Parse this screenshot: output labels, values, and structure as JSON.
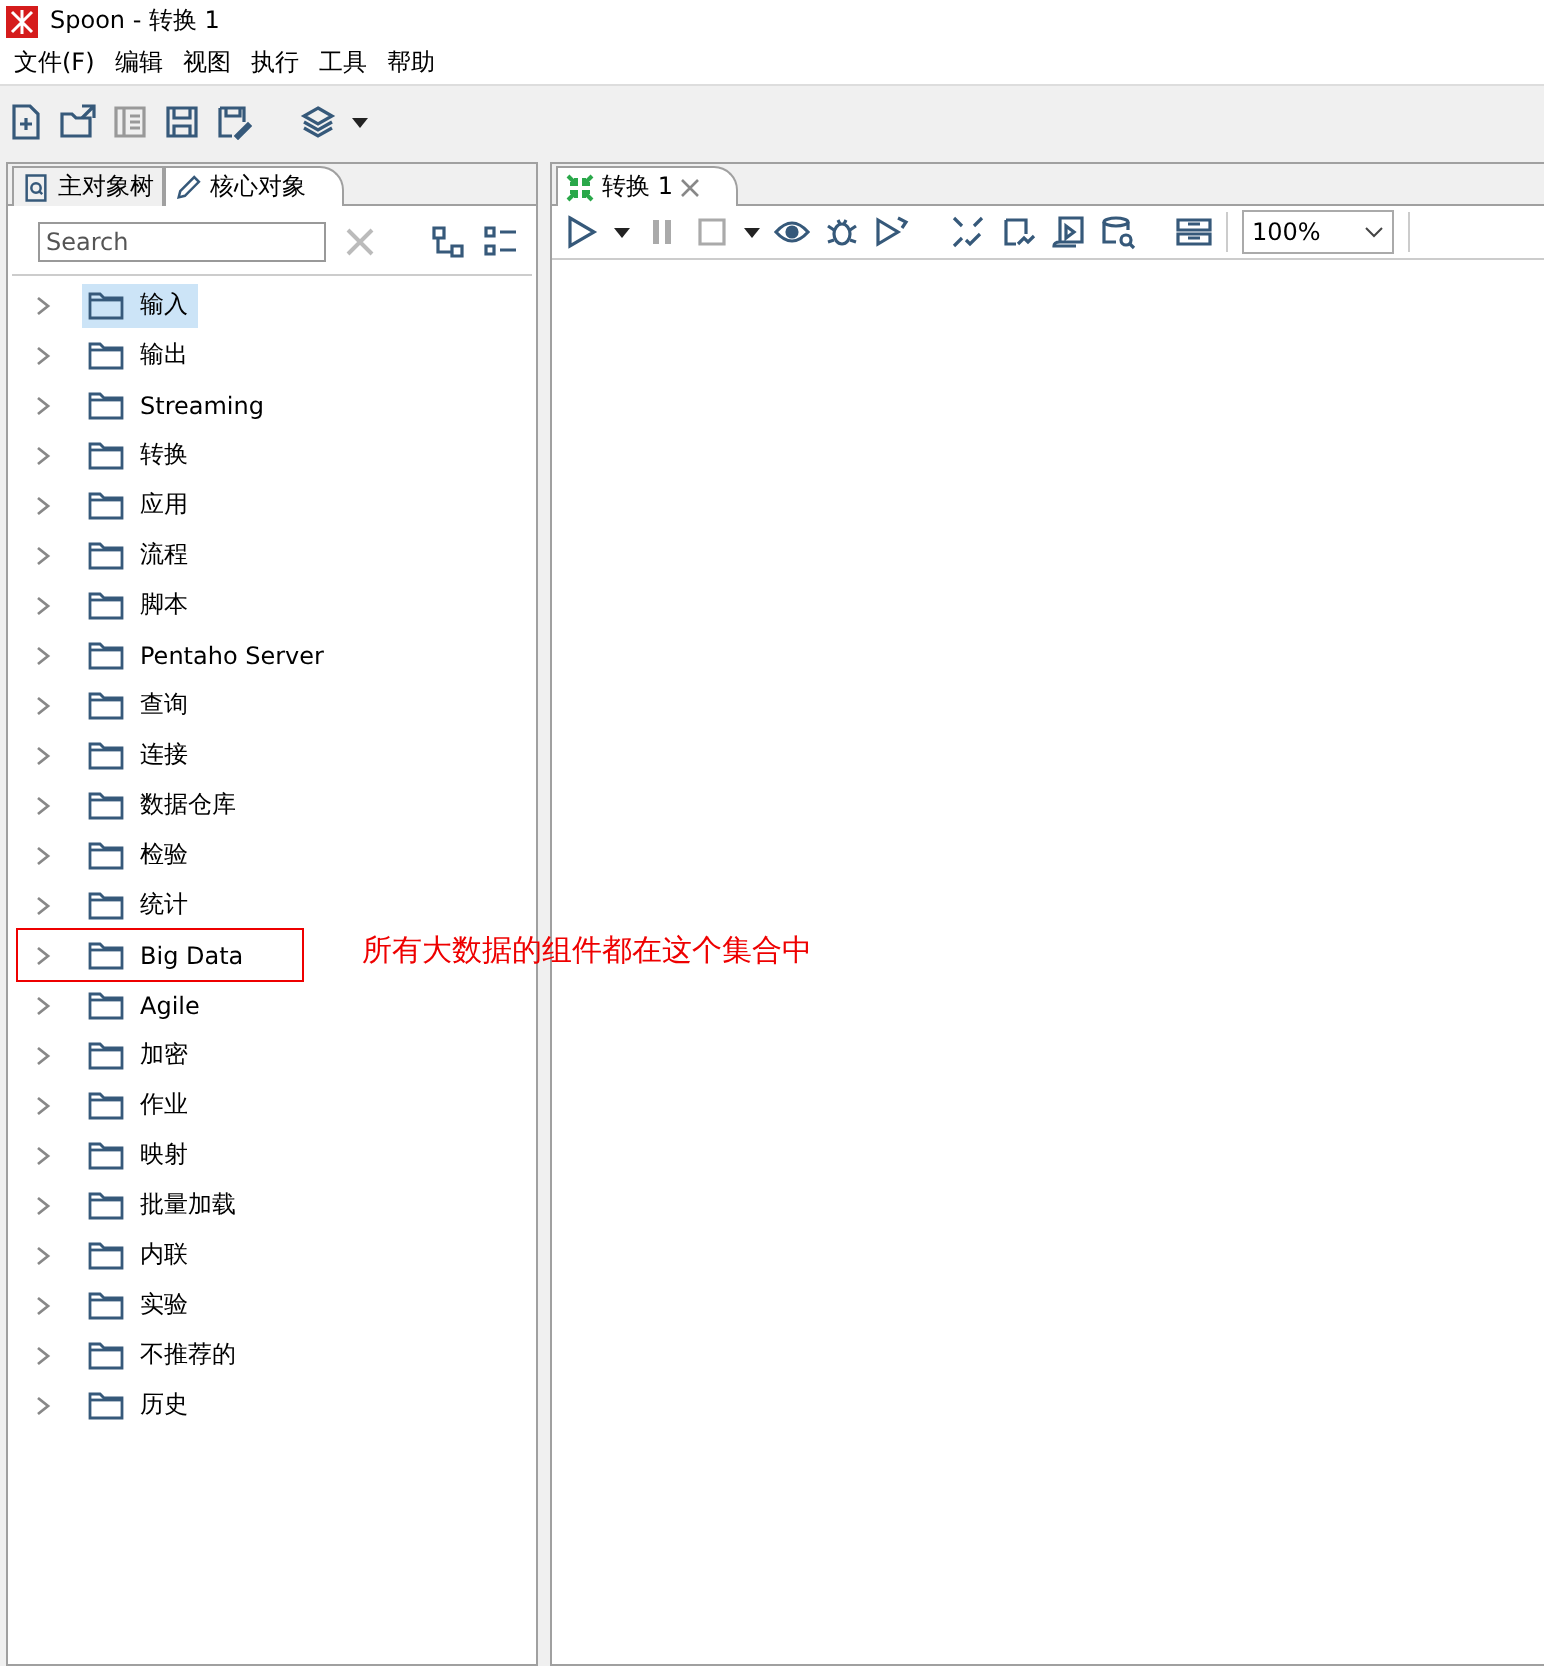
{
  "window": {
    "title": "Spoon - 转换 1"
  },
  "menu": [
    "文件(F)",
    "编辑",
    "视图",
    "执行",
    "工具",
    "帮助"
  ],
  "left_tabs": [
    {
      "label": "主对象树",
      "selected": false,
      "kind": "tree"
    },
    {
      "label": "核心对象",
      "selected": true,
      "kind": "pencil"
    }
  ],
  "search": {
    "placeholder": "Search"
  },
  "tree": [
    {
      "label": "输入",
      "selected": true
    },
    {
      "label": "输出",
      "selected": false
    },
    {
      "label": "Streaming",
      "selected": false
    },
    {
      "label": "转换",
      "selected": false
    },
    {
      "label": "应用",
      "selected": false
    },
    {
      "label": "流程",
      "selected": false
    },
    {
      "label": "脚本",
      "selected": false
    },
    {
      "label": "Pentaho Server",
      "selected": false
    },
    {
      "label": "查询",
      "selected": false
    },
    {
      "label": "连接",
      "selected": false
    },
    {
      "label": "数据仓库",
      "selected": false
    },
    {
      "label": "检验",
      "selected": false
    },
    {
      "label": "统计",
      "selected": false
    },
    {
      "label": "Big Data",
      "selected": false,
      "note": "所有大数据的组件都在这个集合中"
    },
    {
      "label": "Agile",
      "selected": false
    },
    {
      "label": "加密",
      "selected": false
    },
    {
      "label": "作业",
      "selected": false
    },
    {
      "label": "映射",
      "selected": false
    },
    {
      "label": "批量加载",
      "selected": false
    },
    {
      "label": "内联",
      "selected": false
    },
    {
      "label": "实验",
      "selected": false
    },
    {
      "label": "不推荐的",
      "selected": false
    },
    {
      "label": "历史",
      "selected": false
    }
  ],
  "editor_tabs": [
    {
      "label": "转换 1",
      "selected": true
    }
  ],
  "zoom": {
    "value": "100%"
  }
}
